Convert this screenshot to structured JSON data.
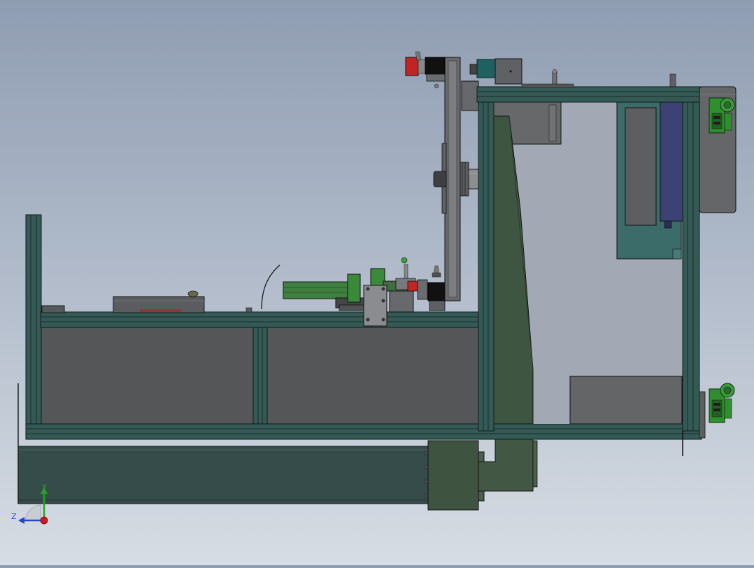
{
  "colors": {
    "background_top": "#8f9db2",
    "background_bottom": "#d7dde4",
    "frame_teal": "#345a56",
    "frame_edge": "#1e2e2d",
    "panel_dark": "#555658",
    "panel_gray": "#626366",
    "olive_green": "#3f5341",
    "bright_green": "#3b9a3b",
    "red_part": "#c22424",
    "navy_part": "#3d4275",
    "axis_x": "#d01818",
    "axis_y": "#28a028",
    "axis_z": "#2846c8"
  },
  "triad": {
    "y_label": "Y",
    "z_label": "Z"
  }
}
